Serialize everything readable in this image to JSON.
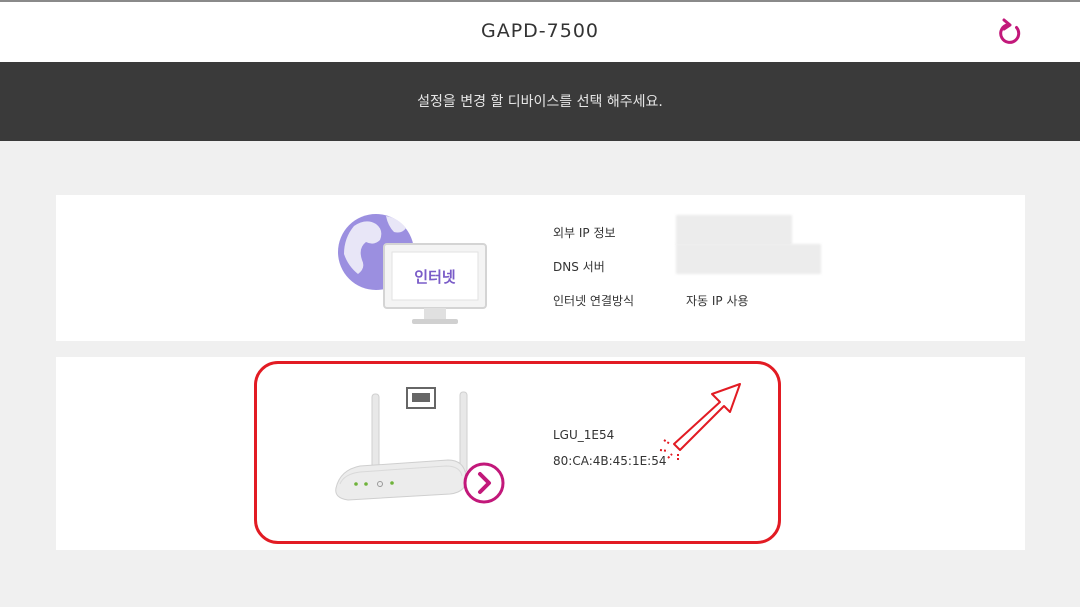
{
  "header": {
    "title": "GAPD-7500",
    "refresh_icon": "refresh-icon",
    "accent_color": "#c2187a"
  },
  "banner": {
    "message": "설정을 변경 할 디바이스를 선택 해주세요."
  },
  "internet_card": {
    "icon_label": "인터넷",
    "rows": [
      {
        "label": "외부 IP 정보",
        "value": ""
      },
      {
        "label": "DNS 서버",
        "value": ""
      },
      {
        "label": "인터넷 연결방식",
        "value": "자동 IP 사용"
      }
    ]
  },
  "device_card": {
    "name": "LGU_1E54",
    "mac": "80:CA:4B:45:1E:54",
    "go_icon": "chevron-right-icon",
    "highlight_color": "#e21b23"
  }
}
